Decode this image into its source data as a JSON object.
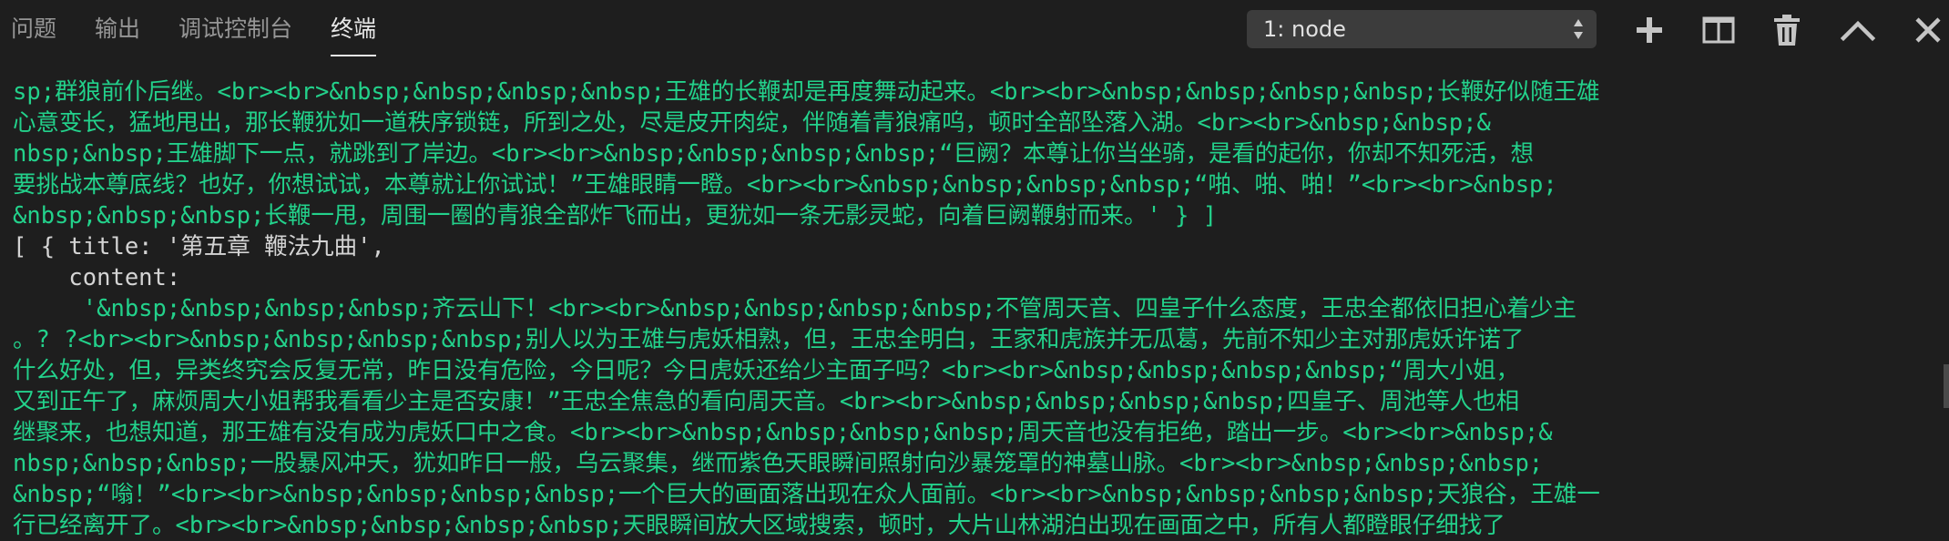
{
  "tabs": [
    {
      "label": "问题"
    },
    {
      "label": "输出"
    },
    {
      "label": "调试控制台"
    },
    {
      "label": "终端",
      "active": true
    }
  ],
  "terminal_select": {
    "value": "1: node"
  },
  "toolbar": {
    "icons": [
      "plus-icon",
      "split-icon",
      "trash-icon",
      "chevron-up-icon",
      "close-icon"
    ]
  },
  "terminal": {
    "lines": [
      {
        "text": "sp;群狼前仆后继。<br><br>&nbsp;&nbsp;&nbsp;&nbsp;王雄的长鞭却是再度舞动起来。<br><br>&nbsp;&nbsp;&nbsp;&nbsp;长鞭好似随王雄",
        "color": "green"
      },
      {
        "text": "心意变长，猛地甩出，那长鞭犹如一道秩序锁链，所到之处，尽是皮开肉绽，伴随着青狼痛呜，顿时全部坠落入湖。<br><br>&nbsp;&nbsp;&",
        "color": "green"
      },
      {
        "text": "nbsp;&nbsp;王雄脚下一点，就跳到了岸边。<br><br>&nbsp;&nbsp;&nbsp;&nbsp;“巨阙？本尊让你当坐骑，是看的起你，你却不知死活，想",
        "color": "green"
      },
      {
        "text": "要挑战本尊底线？也好，你想试试，本尊就让你试试！”王雄眼睛一瞪。<br><br>&nbsp;&nbsp;&nbsp;&nbsp;“啪、啪、啪！”<br><br>&nbsp;",
        "color": "green"
      },
      {
        "text": "&nbsp;&nbsp;&nbsp;长鞭一甩，周围一圈的青狼全部炸飞而出，更犹如一条无影灵蛇，向着巨阙鞭射而来。' } ]",
        "color": "green"
      },
      {
        "text": "[ { title: '第五章 鞭法九曲',",
        "color": "white"
      },
      {
        "text": "    content:",
        "color": "white"
      },
      {
        "text": "     '&nbsp;&nbsp;&nbsp;&nbsp;齐云山下！<br><br>&nbsp;&nbsp;&nbsp;&nbsp;不管周天音、四皇子什么态度，王忠全都依旧担心着少主",
        "color": "green"
      },
      {
        "text": "。? ?<br><br>&nbsp;&nbsp;&nbsp;&nbsp;别人以为王雄与虎妖相熟，但，王忠全明白，王家和虎族并无瓜葛，先前不知少主对那虎妖许诺了",
        "color": "green"
      },
      {
        "text": "什么好处，但，异类终究会反复无常，昨日没有危险，今日呢？今日虎妖还给少主面子吗？<br><br>&nbsp;&nbsp;&nbsp;&nbsp;“周大小姐，",
        "color": "green"
      },
      {
        "text": "又到正午了，麻烦周大小姐帮我看看少主是否安康！”王忠全焦急的看向周天音。<br><br>&nbsp;&nbsp;&nbsp;&nbsp;四皇子、周池等人也相",
        "color": "green"
      },
      {
        "text": "继聚来，也想知道，那王雄有没有成为虎妖口中之食。<br><br>&nbsp;&nbsp;&nbsp;&nbsp;周天音也没有拒绝，踏出一步。<br><br>&nbsp;&",
        "color": "green"
      },
      {
        "text": "nbsp;&nbsp;&nbsp;一股暴风冲天，犹如昨日一般，乌云聚集，继而紫色天眼瞬间照射向沙暴笼罩的神墓山脉。<br><br>&nbsp;&nbsp;&nbsp;",
        "color": "green"
      },
      {
        "text": "&nbsp;“嗡！”<br><br>&nbsp;&nbsp;&nbsp;&nbsp;一个巨大的画面落出现在众人面前。<br><br>&nbsp;&nbsp;&nbsp;&nbsp;天狼谷，王雄一",
        "color": "green"
      },
      {
        "text": "行已经离开了。<br><br>&nbsp;&nbsp;&nbsp;&nbsp;天眼瞬间放大区域搜索，顿时，大片山林湖泊出现在画面之中，所有人都瞪眼仔细找了",
        "color": "green"
      }
    ]
  }
}
